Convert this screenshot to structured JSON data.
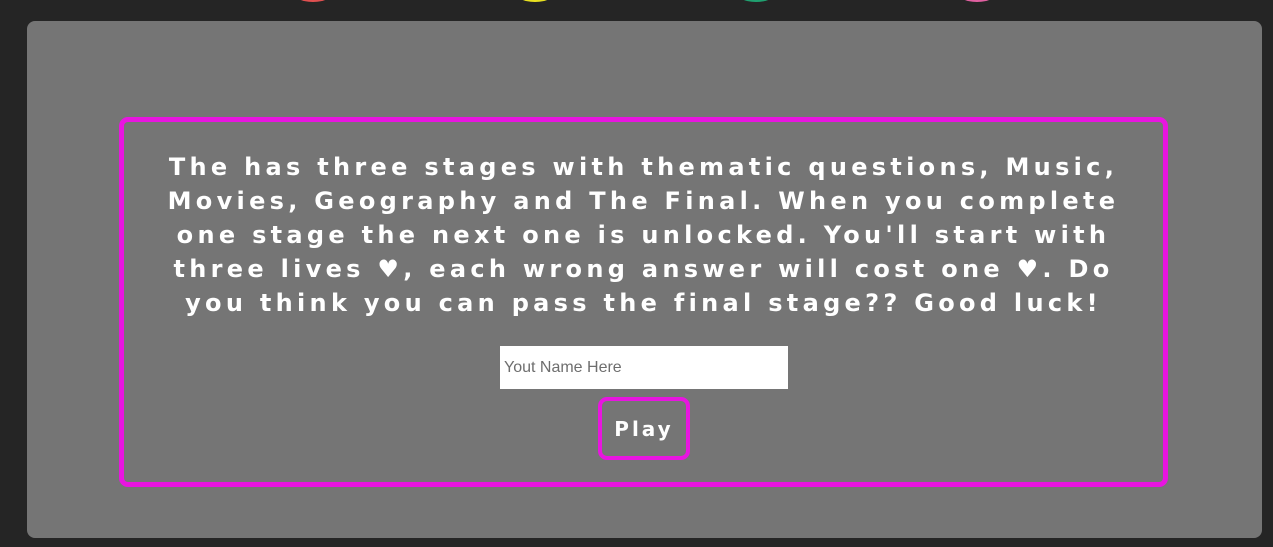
{
  "intro": {
    "text": "The has three stages with thematic questions, Music, Movies, Geography and The Final. When you complete one stage the next one is unlocked. You'll start with three lives ♥, each wrong answer will cost one ♥. Do you think you can pass the final stage?? Good luck!",
    "life_icon": "heart-icon"
  },
  "name_input": {
    "placeholder": "Yout Name Here",
    "value": ""
  },
  "play_button": {
    "label": "Play"
  },
  "colors": {
    "page_background": "#252525",
    "panel_background": "#757575",
    "accent": "#e815e0",
    "text": "#ffffff",
    "stage_dots": [
      "#e05050",
      "#e8e020",
      "#20a070",
      "#e060a0"
    ]
  }
}
